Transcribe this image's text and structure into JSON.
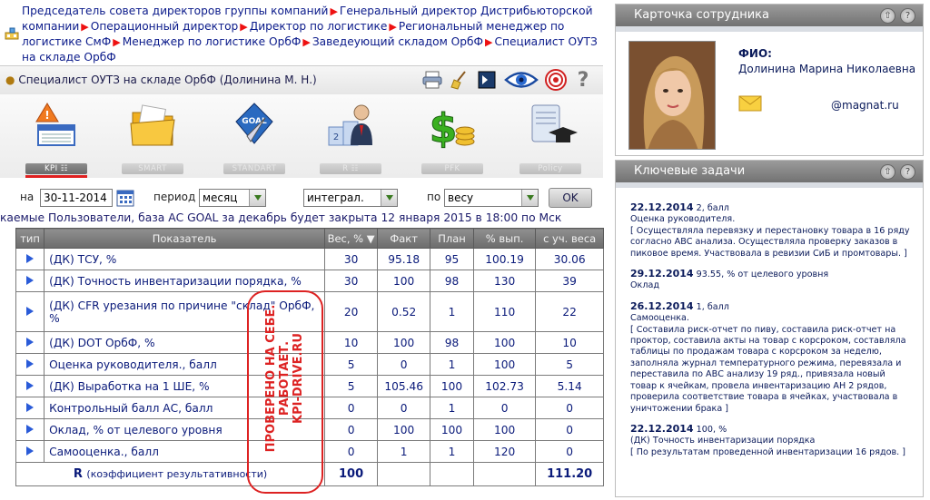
{
  "breadcrumb": {
    "items": [
      "Председатель совета директоров группы компаний",
      "Генеральный директор Дистрибьюторской компании",
      "Операционный директор",
      "Директор по логистике",
      "Региональный менеджер по логистике СмФ",
      "Менеджер по логистике ОрбФ",
      "Заведеующий складом ОрбФ",
      "Специалист ОУТЗ на складе ОрбФ"
    ]
  },
  "userbar": {
    "title": "Специалист ОУТЗ на складе ОрбФ  (Долинина М. Н.)",
    "tools": [
      "printer-icon",
      "broom-icon",
      "screen-icon",
      "eye-icon",
      "target-icon",
      "help-icon"
    ]
  },
  "modules": [
    {
      "label": "KPI ☷",
      "icon": "kpi-warning-icon",
      "active": true
    },
    {
      "label": "SMART",
      "icon": "folder-icon",
      "active": false
    },
    {
      "label": "STANDART",
      "icon": "goal-compass-icon",
      "active": false
    },
    {
      "label": "R ☷",
      "icon": "podium-user-icon",
      "active": false
    },
    {
      "label": "PFK",
      "icon": "money-icon",
      "active": false
    },
    {
      "label": "Policy",
      "icon": "scroll-graduation-icon",
      "active": false
    }
  ],
  "filters": {
    "date_label": "на",
    "date_value": "30-11-2014",
    "period_label": "период",
    "period_value": "месяц",
    "mode_value": "интеграл.",
    "by_label": "по",
    "by_value": "весу",
    "ok_label": "OK"
  },
  "notice": "каемые Пользователи, база АС GOAL за декабрь будет закрыта 12 января 2015 в 18:00 по Мск",
  "table": {
    "headers": [
      "тип",
      "Показатель",
      "Вес, % ▼",
      "Факт",
      "План",
      "% вып.",
      "с уч. веса"
    ],
    "rows": [
      {
        "name": "(ДК) ТСУ, %",
        "weight": "30",
        "fact": "95.18",
        "plan": "95",
        "pct": "100.19",
        "weighted": "30.06"
      },
      {
        "name": "(ДК) Точность инвентаризации порядка, %",
        "weight": "30",
        "fact": "100",
        "plan": "98",
        "pct": "130",
        "weighted": "39"
      },
      {
        "name": "(ДК) CFR урезания по причине \"склад\" ОрбФ, %",
        "weight": "20",
        "fact": "0.52",
        "plan": "1",
        "pct": "110",
        "weighted": "22"
      },
      {
        "name": "(ДК) DOT ОрбФ, %",
        "weight": "10",
        "fact": "100",
        "plan": "98",
        "pct": "100",
        "weighted": "10"
      },
      {
        "name": "Оценка руководителя., балл",
        "weight": "5",
        "fact": "0",
        "plan": "1",
        "pct": "100",
        "weighted": "5"
      },
      {
        "name": "(ДК) Выработка на 1 ШЕ, %",
        "weight": "5",
        "fact": "105.46",
        "plan": "100",
        "pct": "102.73",
        "weighted": "5.14"
      },
      {
        "name": "Контрольный балл АС, балл",
        "weight": "0",
        "fact": "0",
        "plan": "1",
        "pct": "0",
        "weighted": "0"
      },
      {
        "name": "Оклад, % от целевого уровня",
        "weight": "0",
        "fact": "100",
        "plan": "100",
        "pct": "100",
        "weighted": "0"
      },
      {
        "name": "Самооценка., балл",
        "weight": "0",
        "fact": "1",
        "plan": "1",
        "pct": "120",
        "weighted": "0"
      }
    ],
    "total": {
      "label": "R",
      "sublabel": "(коэффициент результативности)",
      "weight": "100",
      "weighted": "111.20"
    }
  },
  "stamp": {
    "lines": [
      "ПРОВЕРЕНО НА СЕБЕ.",
      "РАБОТАЕТ.",
      "KPI-DRIVE.RU"
    ],
    "color": "#d22222"
  },
  "card": {
    "title": "Карточка сотрудника",
    "fio_label": "ФИО:",
    "fio_value": "Долинина Марина Николаевна",
    "email": "@magnat.ru"
  },
  "tasks": {
    "title": "Ключевые задачи",
    "items": [
      {
        "date": "22.12.2014",
        "value": "2, балл",
        "title": "Оценка руководителя.",
        "text": "[ Осуществляла перевязку и перестановку товара в 16 ряду согласно АВС анализа. Осуществляла проверку заказов в пиковое время. Участвовала в ревизии СиБ и промтовары. ]"
      },
      {
        "date": "29.12.2014",
        "value": "93.55, % от целевого уровня",
        "title": "Оклад",
        "text": ""
      },
      {
        "date": "26.12.2014",
        "value": "1, балл",
        "title": "Самооценка.",
        "text": "[ Составила риск-отчет по пиву, составила риск-отчет на проктор, составила акты на товар с корсроком, составляла таблицы по продажам товара с корсроком за неделю, заполняла журнал температурного режима, перевязала и переставила по АВС анализу 19 ряд., привязала новый товар к ячейкам, провела инвентаризацию АН 2 рядов, проверила соответствие товара в ячейках, участвовала в уничтожении брака ]"
      },
      {
        "date": "22.12.2014",
        "value": "100, %",
        "title": "(ДК) Точность инвентаризации порядка",
        "text": "[ По результатам проведенной инвентаризации 16 рядов. ]"
      }
    ]
  }
}
